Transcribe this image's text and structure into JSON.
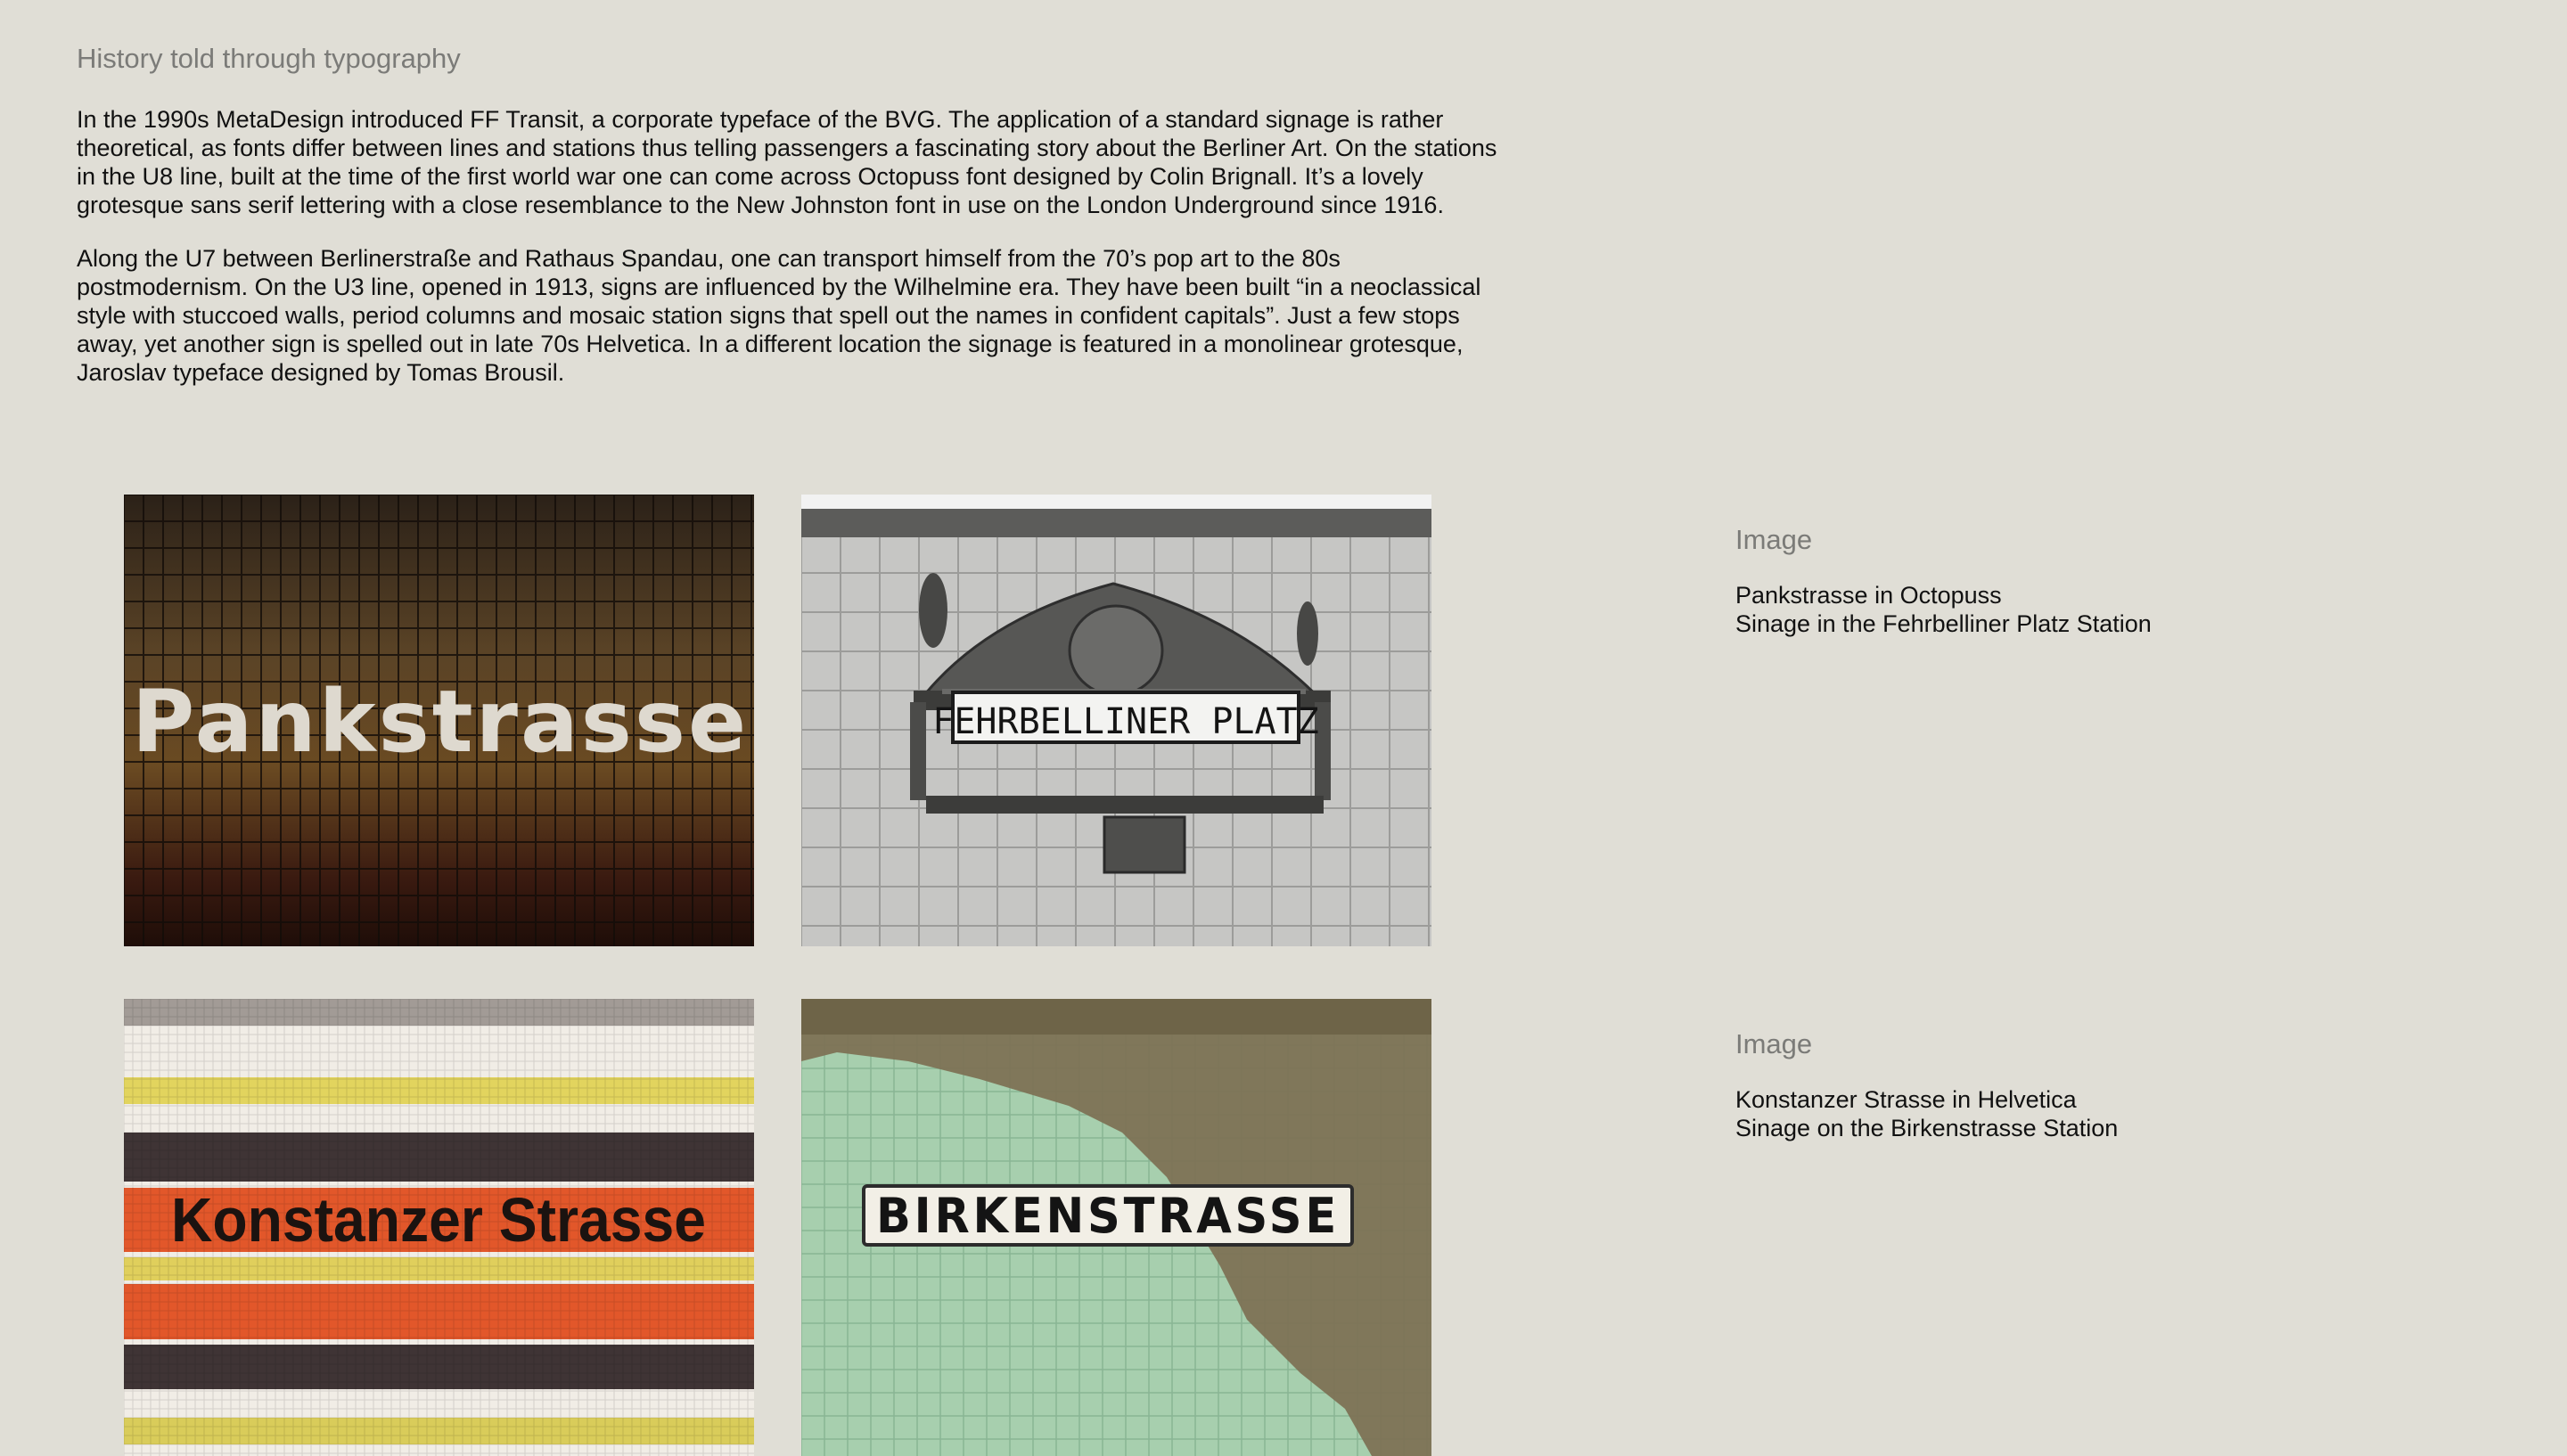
{
  "section": {
    "heading": "History told through typography",
    "paragraphs": [
      "In the 1990s MetaDesign introduced FF Transit, a corporate typeface of the BVG. The application of a standard signage is rather theoretical, as fonts differ between lines and stations thus telling passengers a fascinating story about the Berliner Art. On the stations in the U8 line, built at the time of the first world war one can come across Octopuss font designed by Colin Brignall. It’s a lovely grotesque sans serif lettering with a close resemblance to the New Johnston font in use on the London Underground since 1916.",
      "Along the U7 between Berlinerstraße and Rathaus Spandau, one can transport himself from the 70’s pop art to the 80s postmodernism. On the U3 line, opened in 1913, signs are influenced by the Wilhelmine era. They have been built “in a neoclassical style with stuccoed walls, period columns and mosaic station signs that spell out the names in confident capitals”. Just a few stops away, yet another sign is spelled out in late 70s Helvetica. In a different location the signage is featured in a monolinear grotesque, Jaroslav typeface designed by Tomas Brousil."
    ]
  },
  "photos": [
    {
      "sign_text": "Pankstrasse",
      "tone": "#3d2a1a"
    },
    {
      "sign_text": "FEHRBELLINER PLATZ",
      "tone": "#c4c4c4"
    },
    {
      "sign_text": "Konstanzer Strasse",
      "tone": "#e2572a"
    },
    {
      "sign_text": "BIRKENSTRASSE",
      "tone": "#a7cfae"
    }
  ],
  "captions": [
    {
      "title": "Image",
      "lines": [
        "Pankstrasse in Octopuss",
        "Sinage in the Fehrbelliner Platz Station"
      ]
    },
    {
      "title": "Image",
      "lines": [
        "Konstanzer Strasse in Helvetica",
        "Sinage on the Birkenstrasse Station"
      ]
    }
  ],
  "colors": {
    "background": "#e0ded6",
    "heading": "#7b7b78",
    "body_text": "#111111"
  }
}
